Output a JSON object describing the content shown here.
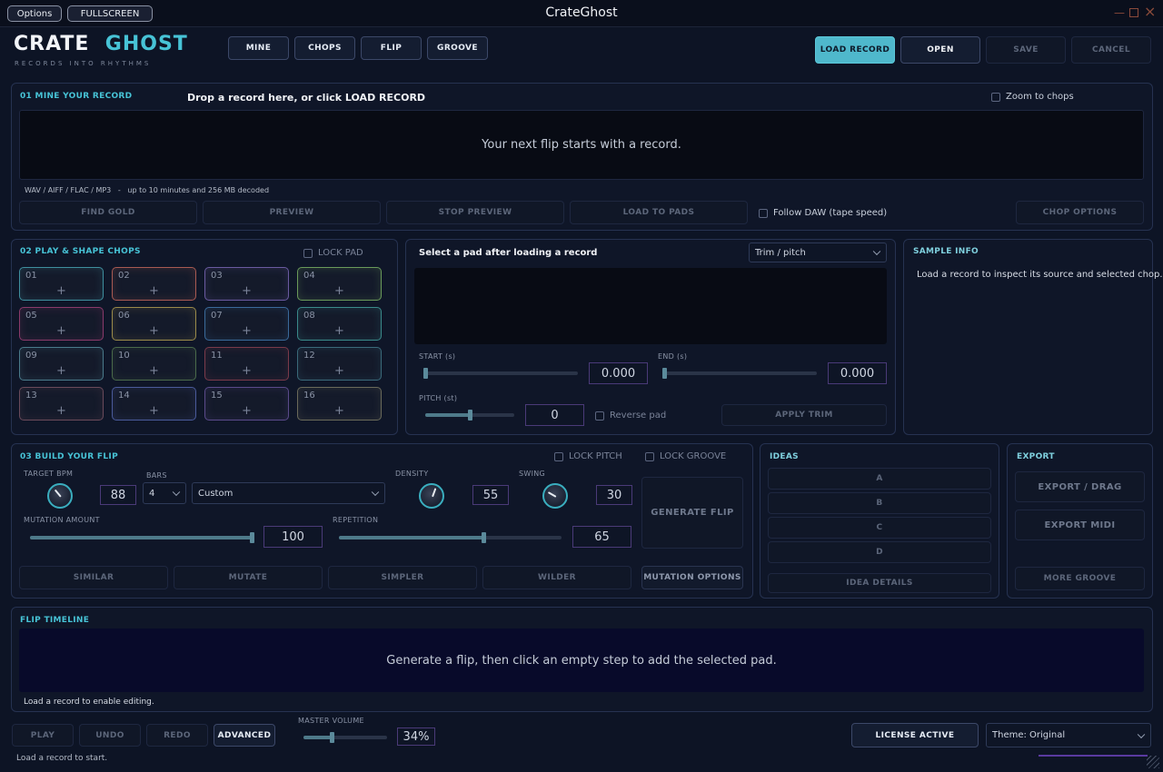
{
  "window": {
    "title": "CrateGhost",
    "options_label": "Options",
    "fullscreen_label": "FULLSCREEN"
  },
  "brand": {
    "word1": "CRATE",
    "word2": "GHOST",
    "tagline": "RECORDS INTO RHYTHMS"
  },
  "nav_tabs": [
    "MINE",
    "CHOPS",
    "FLIP",
    "GROOVE"
  ],
  "top_actions": {
    "load": "LOAD RECORD",
    "open": "OPEN",
    "save": "SAVE",
    "cancel": "CANCEL"
  },
  "mine": {
    "title": "01  MINE YOUR RECORD",
    "drop_hint": "Drop a record here, or click LOAD RECORD",
    "zoom_label": "Zoom to chops",
    "waveform_text": "Your next flip starts with a record.",
    "formats": "WAV / AIFF / FLAC / MP3   -   up to 10 minutes and 256 MB decoded",
    "buttons": [
      "FIND GOLD",
      "PREVIEW",
      "STOP PREVIEW",
      "LOAD TO PADS"
    ],
    "follow_daw": "Follow DAW (tape speed)",
    "chop_options": "CHOP OPTIONS"
  },
  "play": {
    "title": "02  PLAY & SHAPE CHOPS",
    "lock_pad": "LOCK PAD",
    "pads": [
      {
        "num": "01",
        "color": "#3f8f9e"
      },
      {
        "num": "02",
        "color": "#a85a52"
      },
      {
        "num": "03",
        "color": "#6a5aa0"
      },
      {
        "num": "04",
        "color": "#6a9a5a"
      },
      {
        "num": "05",
        "color": "#8a3a6a"
      },
      {
        "num": "06",
        "color": "#9a8a4a"
      },
      {
        "num": "07",
        "color": "#3a6a9a"
      },
      {
        "num": "08",
        "color": "#3a8a8a"
      },
      {
        "num": "09",
        "color": "#4a7a8a"
      },
      {
        "num": "10",
        "color": "#4a6a4a"
      },
      {
        "num": "11",
        "color": "#7a3a4a"
      },
      {
        "num": "12",
        "color": "#3a6a7a"
      },
      {
        "num": "13",
        "color": "#6a4a5a"
      },
      {
        "num": "14",
        "color": "#4a5a9a"
      },
      {
        "num": "15",
        "color": "#5a4a8a"
      },
      {
        "num": "16",
        "color": "#6a6a5a"
      }
    ],
    "plus": "+"
  },
  "editor": {
    "title": "Select a pad after loading a record",
    "mode": "Trim / pitch",
    "start_label": "START (s)",
    "start_value": "0.000",
    "start_level": 0,
    "end_label": "END (s)",
    "end_value": "0.000",
    "end_level": 0,
    "pitch_label": "PITCH (st)",
    "pitch_value": "0",
    "pitch_level": 0.5,
    "reverse": "Reverse pad",
    "apply": "APPLY TRIM"
  },
  "sample": {
    "title": "SAMPLE INFO",
    "text": "Load a record to inspect its source and selected chop."
  },
  "build": {
    "title": "03  BUILD YOUR FLIP",
    "lock_pitch": "LOCK PITCH",
    "lock_groove": "LOCK GROOVE",
    "bpm_label": "TARGET BPM",
    "bpm": "88",
    "bars_label": "BARS",
    "bars": "4",
    "preset": "Custom",
    "density_label": "DENSITY",
    "density": "55",
    "swing_label": "SWING",
    "swing": "30",
    "generate": "GENERATE FLIP",
    "mutation_label": "MUTATION AMOUNT",
    "mutation": "100",
    "mutation_level": 1.0,
    "repetition_label": "REPETITION",
    "repetition": "65",
    "repetition_level": 0.65,
    "actions": [
      "SIMILAR",
      "MUTATE",
      "SIMPLER",
      "WILDER",
      "MUTATION OPTIONS"
    ]
  },
  "ideas": {
    "title": "IDEAS",
    "items": [
      "A",
      "B",
      "C",
      "D"
    ],
    "details": "IDEA DETAILS"
  },
  "export": {
    "title": "EXPORT",
    "drag": "EXPORT / DRAG",
    "midi": "EXPORT MIDI",
    "more": "MORE GROOVE"
  },
  "timeline": {
    "title": "FLIP TIMELINE",
    "hint": "Generate a flip, then click an empty step to add the selected pad.",
    "status": "Load a record to enable editing."
  },
  "transport": {
    "play": "PLAY",
    "undo": "UNDO",
    "redo": "REDO",
    "advanced": "ADVANCED",
    "volume_label": "MASTER VOLUME",
    "volume": "34%",
    "volume_level": 0.34,
    "license": "LICENSE ACTIVE",
    "theme": "Theme: Original",
    "status": "Load a record to start."
  },
  "colors": {
    "accent": "#47c3d6",
    "load_button": "#4fb8cc"
  }
}
